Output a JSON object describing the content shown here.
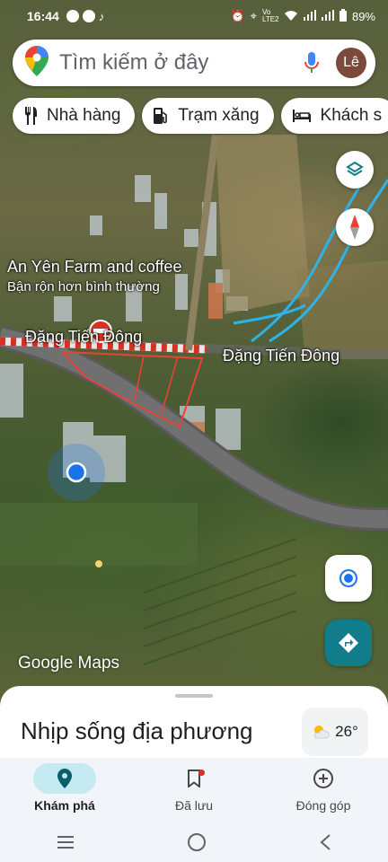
{
  "status_bar": {
    "time": "16:44",
    "battery": "89%",
    "network": "Vo LTE2"
  },
  "search": {
    "placeholder": "Tìm kiếm ở đây",
    "avatar_letter": "Lê"
  },
  "chips": [
    {
      "label": "Nhà hàng",
      "icon": "restaurant-icon"
    },
    {
      "label": "Trạm xăng",
      "icon": "gas-station-icon"
    },
    {
      "label": "Khách s",
      "icon": "hotel-icon"
    }
  ],
  "map": {
    "place": {
      "name": "An Yên Farm and coffee",
      "status": "Bận rộn hơn bình thường"
    },
    "road_labels": [
      "Đặng Tiến Đông",
      "Đặng Tiến Đông"
    ],
    "watermark": "Google Maps"
  },
  "sheet": {
    "title": "Nhịp sống địa phương",
    "weather_temp": "26°",
    "weather_icon": "partly-cloudy-icon"
  },
  "tabs": [
    {
      "label": "Khám phá",
      "icon": "explore-pin-icon",
      "active": true
    },
    {
      "label": "Đã lưu",
      "icon": "bookmark-icon",
      "active": false
    },
    {
      "label": "Đóng góp",
      "icon": "add-circle-icon",
      "active": false
    }
  ],
  "colors": {
    "accent_teal": "#117c8a",
    "location_blue": "#1a73e8",
    "active_tab_pill": "#c5eaf2"
  }
}
